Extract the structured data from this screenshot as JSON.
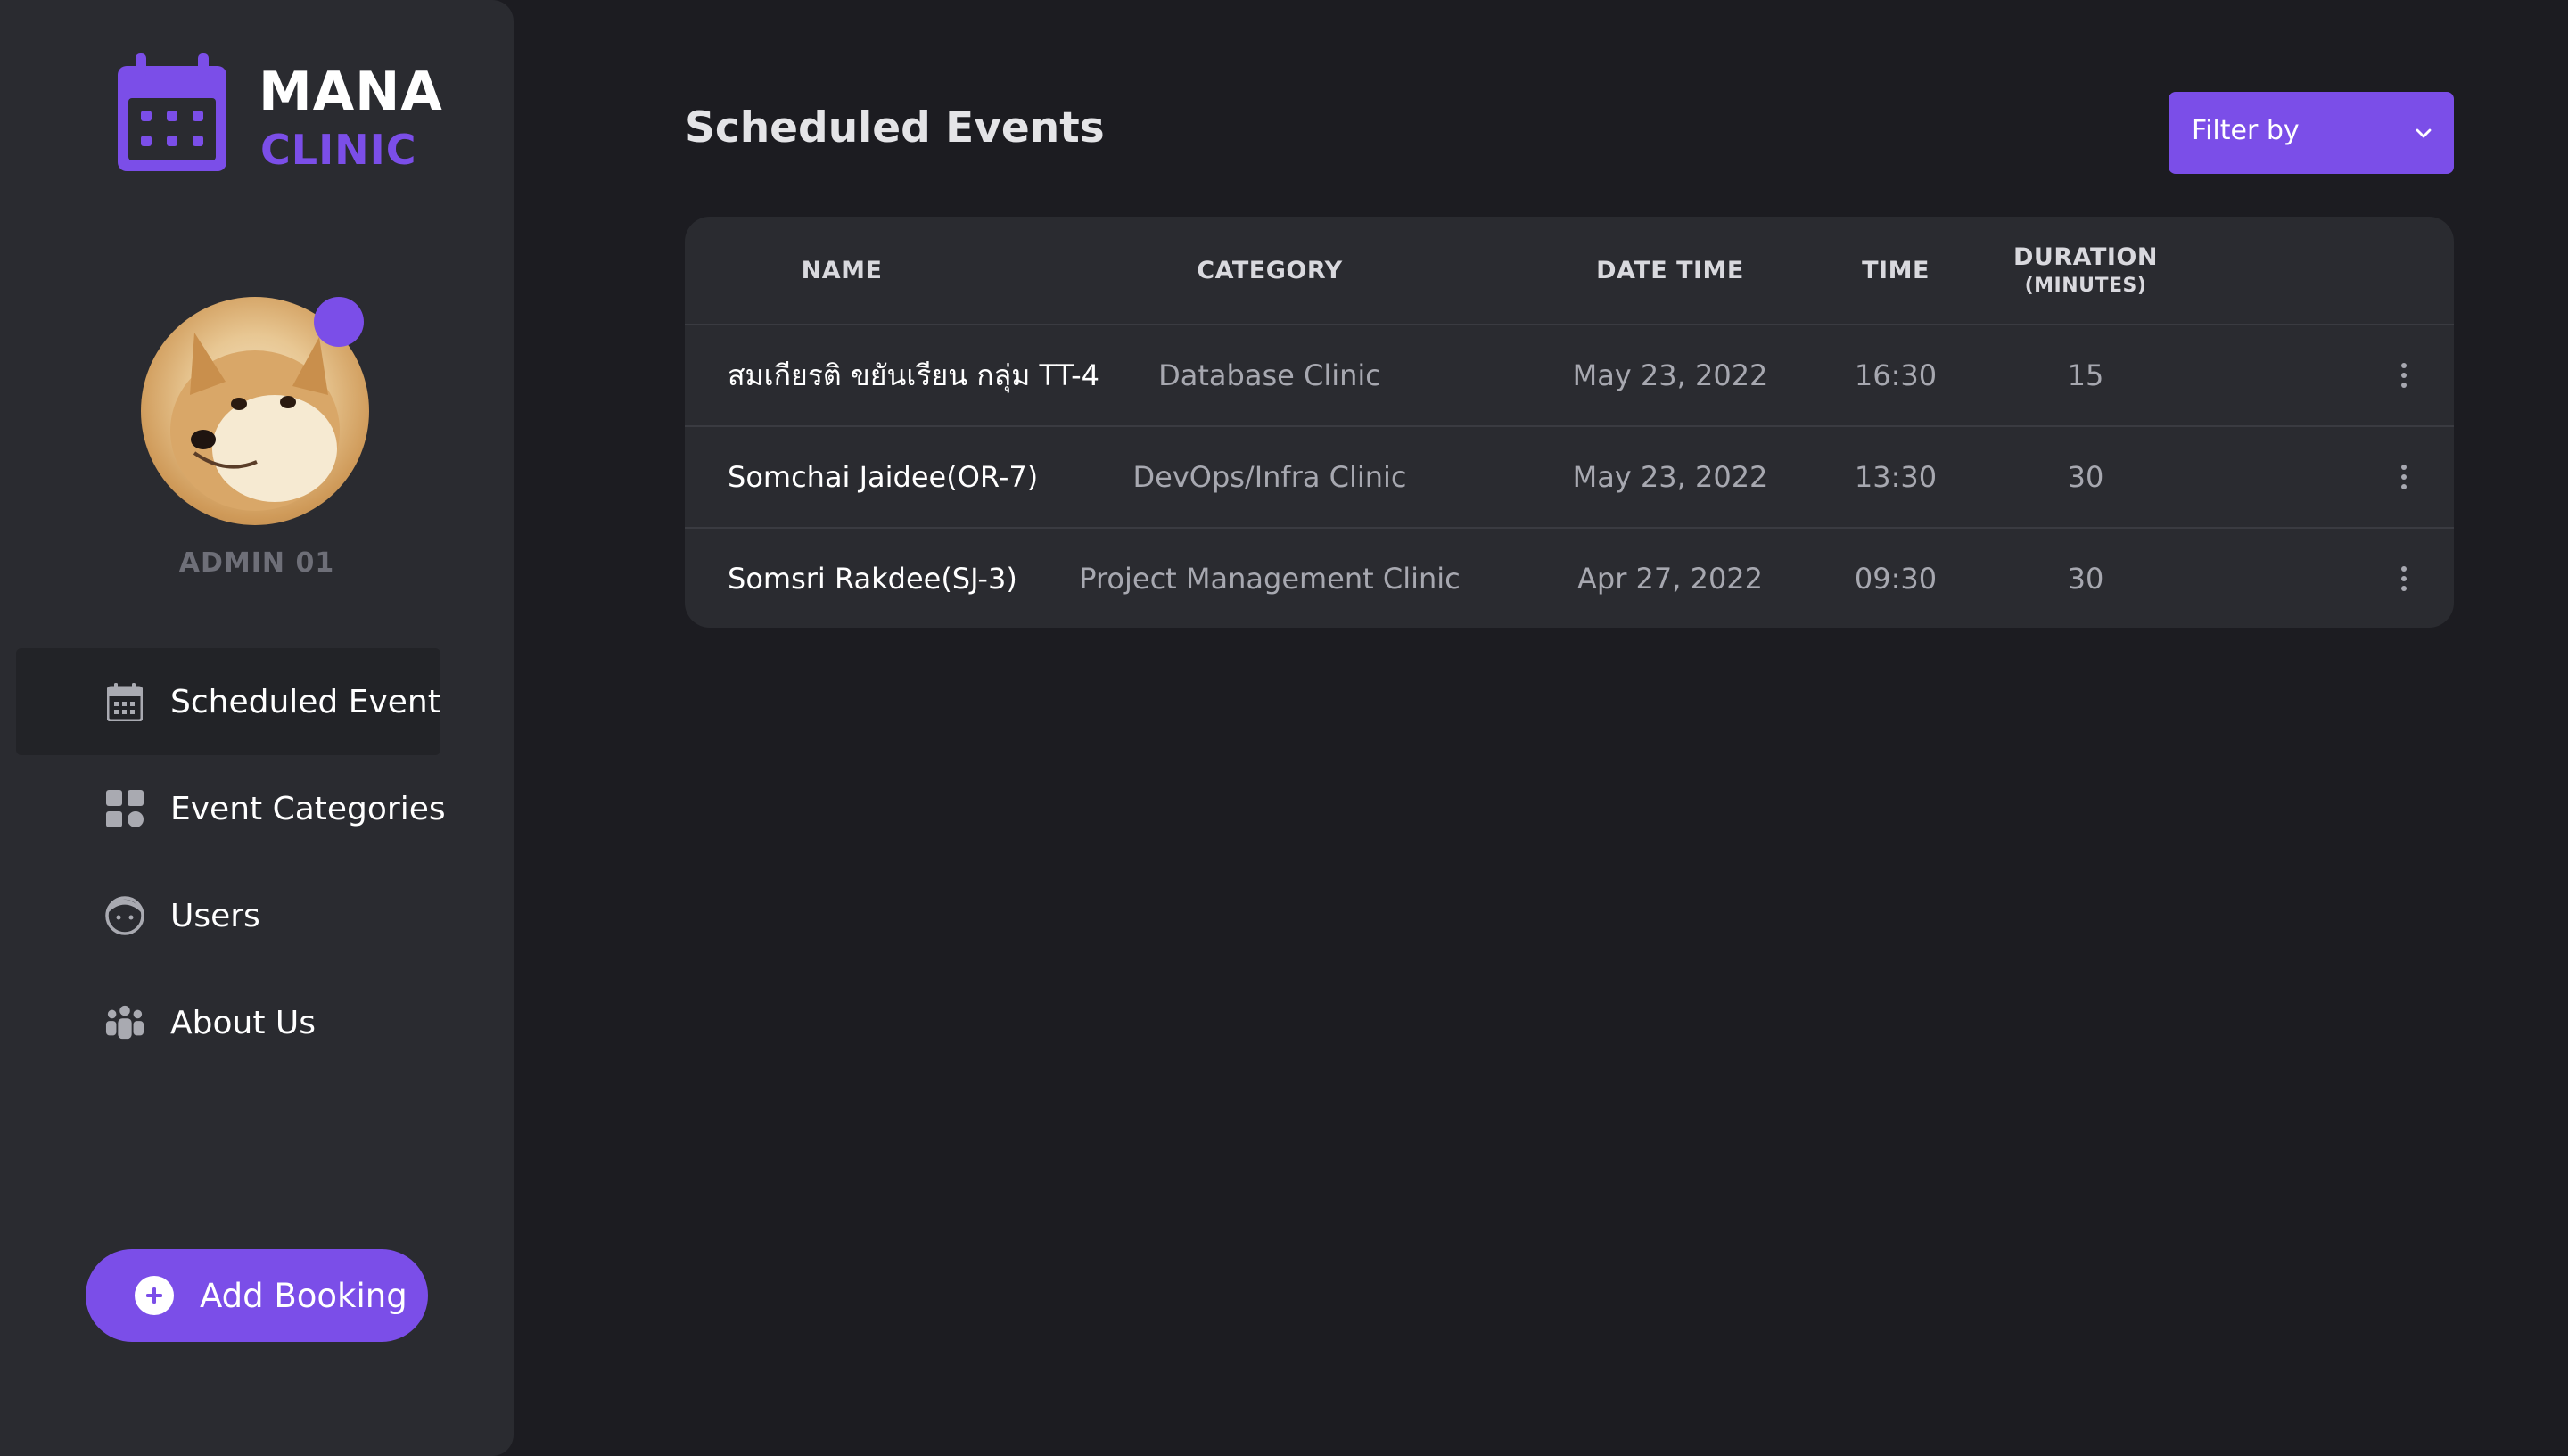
{
  "brand": {
    "word1": "MANA",
    "word2": "CLINIC",
    "icon": "calendar-icon",
    "accent_color": "#7b4ee8"
  },
  "profile": {
    "name": "ADMIN 01",
    "status_color": "#7b4ee8"
  },
  "sidebar": {
    "items": [
      {
        "label": "Scheduled Event",
        "icon": "calendar-icon",
        "active": true
      },
      {
        "label": "Event Categories",
        "icon": "grid-icon",
        "active": false
      },
      {
        "label": "Users",
        "icon": "user-face-icon",
        "active": false
      },
      {
        "label": "About Us",
        "icon": "group-icon",
        "active": false
      }
    ],
    "add_booking_label": "Add Booking"
  },
  "main": {
    "title": "Scheduled Events",
    "filter_label": "Filter by"
  },
  "table": {
    "columns": {
      "name": "NAME",
      "category": "CATEGORY",
      "datetime": "DATE TIME",
      "time": "TIME",
      "duration": "DURATION",
      "duration_unit": "(MINUTES)"
    },
    "rows": [
      {
        "name": "สมเกียรติ ขยันเรียน กลุ่ม TT-4",
        "category": "Database Clinic",
        "date": "May 23, 2022",
        "time": "16:30",
        "duration": "15"
      },
      {
        "name": "Somchai Jaidee(OR-7)",
        "category": "DevOps/Infra Clinic",
        "date": "May 23, 2022",
        "time": "13:30",
        "duration": "30"
      },
      {
        "name": "Somsri Rakdee(SJ-3)",
        "category": "Project Management Clinic",
        "date": "Apr 27, 2022",
        "time": "09:30",
        "duration": "30"
      }
    ]
  }
}
